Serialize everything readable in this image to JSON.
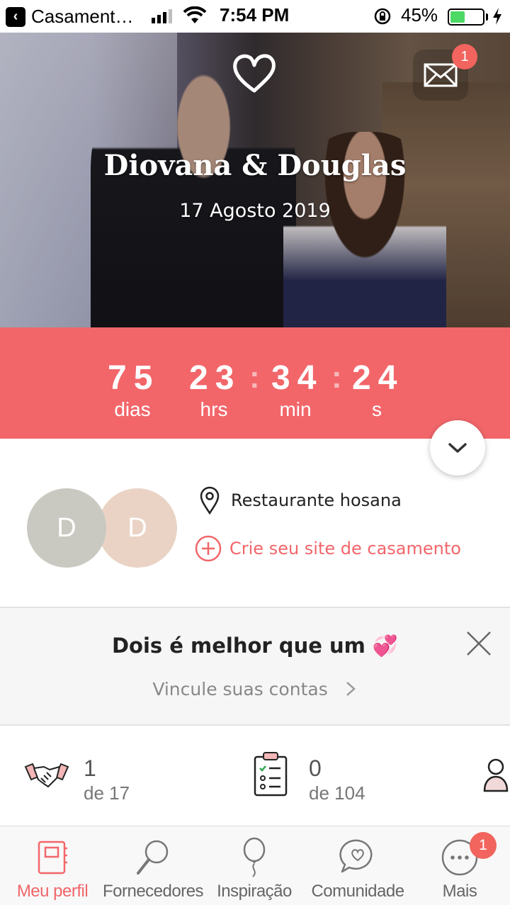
{
  "status_bar": {
    "back_app": "Casament…",
    "time": "7:54 PM",
    "battery": "45%",
    "battery_level": 0.45
  },
  "hero": {
    "names": "Diovana & Douglas",
    "date": "17 Agosto 2019",
    "inbox_badge": "1"
  },
  "countdown": {
    "days": "75",
    "hours": "23",
    "minutes": "34",
    "seconds": "24",
    "days_label": "dias",
    "hours_label": "hrs",
    "minutes_label": "min",
    "seconds_label": "s"
  },
  "profile": {
    "avatar_1_initial": "D",
    "avatar_2_initial": "D",
    "venue": "Restaurante hosana",
    "create_site": "Crie seu site de casamento"
  },
  "link_banner": {
    "title": "Dois é melhor que um 💞",
    "subtitle": "Vincule suas contas"
  },
  "stats": [
    {
      "value": "1",
      "of": "de 17"
    },
    {
      "value": "0",
      "of": "de 104"
    }
  ],
  "tabs": [
    {
      "label": "Meu perfil"
    },
    {
      "label": "Fornecedores"
    },
    {
      "label": "Inspiração"
    },
    {
      "label": "Comunidade"
    },
    {
      "label": "Mais",
      "badge": "1"
    }
  ],
  "colors": {
    "accent": "#f2666a",
    "badge": "#f2645e"
  }
}
